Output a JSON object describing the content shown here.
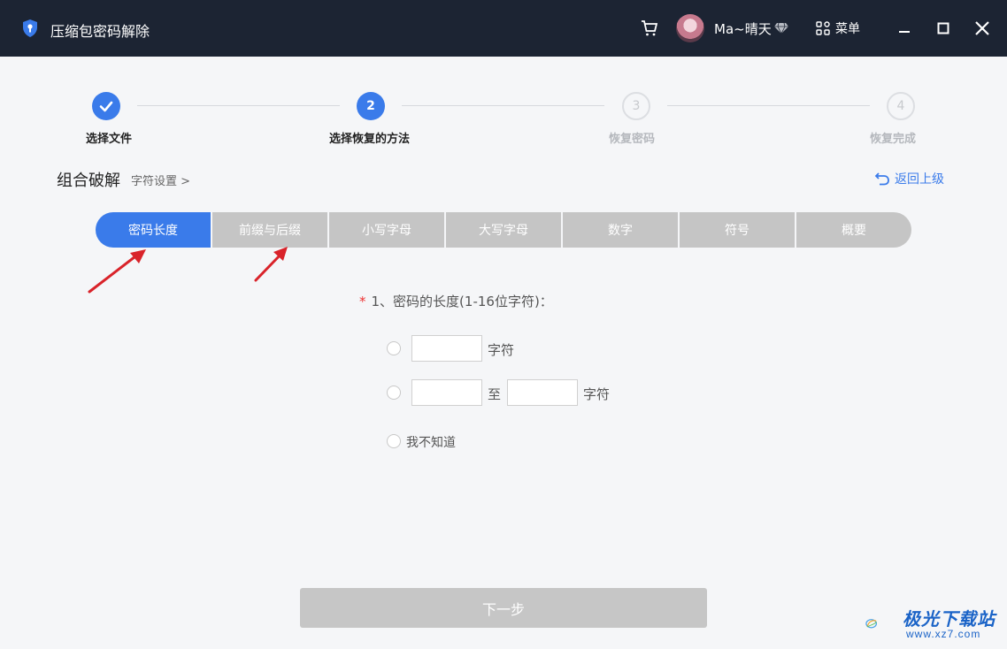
{
  "app": {
    "title": "压缩包密码解除",
    "username": "Ma~晴天",
    "menu_label": "菜单"
  },
  "steps": [
    {
      "label": "选择文件",
      "number": "",
      "state": "done"
    },
    {
      "label": "选择恢复的方法",
      "number": "2",
      "state": "active"
    },
    {
      "label": "恢复密码",
      "number": "3",
      "state": "pending"
    },
    {
      "label": "恢复完成",
      "number": "4",
      "state": "pending"
    }
  ],
  "section": {
    "title": "组合破解",
    "breadcrumb": "字符设置 >",
    "back_label": "返回上级"
  },
  "tabs": [
    {
      "label": "密码长度",
      "active": true
    },
    {
      "label": "前缀与后缀",
      "active": false
    },
    {
      "label": "小写字母",
      "active": false
    },
    {
      "label": "大写字母",
      "active": false
    },
    {
      "label": "数字",
      "active": false
    },
    {
      "label": "符号",
      "active": false
    },
    {
      "label": "概要",
      "active": false
    }
  ],
  "form": {
    "required_mark": "*",
    "question": "1、密码的长度(1-16位字符)：",
    "option1_unit": "字符",
    "option2_to": "至",
    "option2_unit": "字符",
    "option3_label": "我不知道",
    "option1_value": "",
    "range_from_value": "",
    "range_to_value": ""
  },
  "next_label": "下一步",
  "watermark": {
    "name": "极光下载站",
    "url": "www.xz7.com"
  },
  "colors": {
    "titlebar": "#1c2433",
    "accent": "#3a7bea",
    "tab_inactive": "#c5c5c5",
    "button_disabled": "#c6c6c6",
    "arrow": "#d9232a"
  }
}
